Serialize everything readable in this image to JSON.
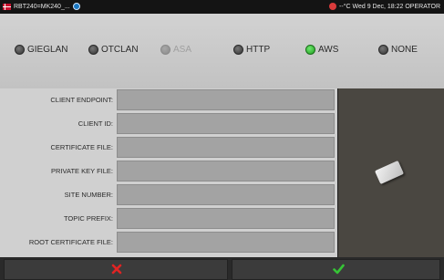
{
  "statusbar": {
    "title": "RBT240=MK240_...",
    "right_text": "--°C Wed 9 Dec, 18:22 OPERATOR"
  },
  "modes": [
    {
      "label": "GIEGLAN",
      "state": "off"
    },
    {
      "label": "OTCLAN",
      "state": "off"
    },
    {
      "label": "ASA",
      "state": "disabled"
    },
    {
      "label": "HTTP",
      "state": "off"
    },
    {
      "label": "AWS",
      "state": "on"
    },
    {
      "label": "NONE",
      "state": "off"
    }
  ],
  "form": {
    "fields": [
      {
        "label": "CLIENT ENDPOINT:",
        "value": ""
      },
      {
        "label": "CLIENT ID:",
        "value": ""
      },
      {
        "label": "CERTIFICATE FILE:",
        "value": ""
      },
      {
        "label": "PRIVATE KEY FILE:",
        "value": ""
      },
      {
        "label": "SITE NUMBER:",
        "value": ""
      },
      {
        "label": "TOPIC PREFIX:",
        "value": ""
      },
      {
        "label": "ROOT CERTIFICATE FILE:",
        "value": ""
      }
    ]
  },
  "icons": {
    "side_icon": "usb-stick-icon",
    "cancel": "cross-icon",
    "ok": "checkmark-icon"
  },
  "colors": {
    "active_led": "#2ecc2e",
    "cancel": "#e02424",
    "ok": "#36c436"
  }
}
